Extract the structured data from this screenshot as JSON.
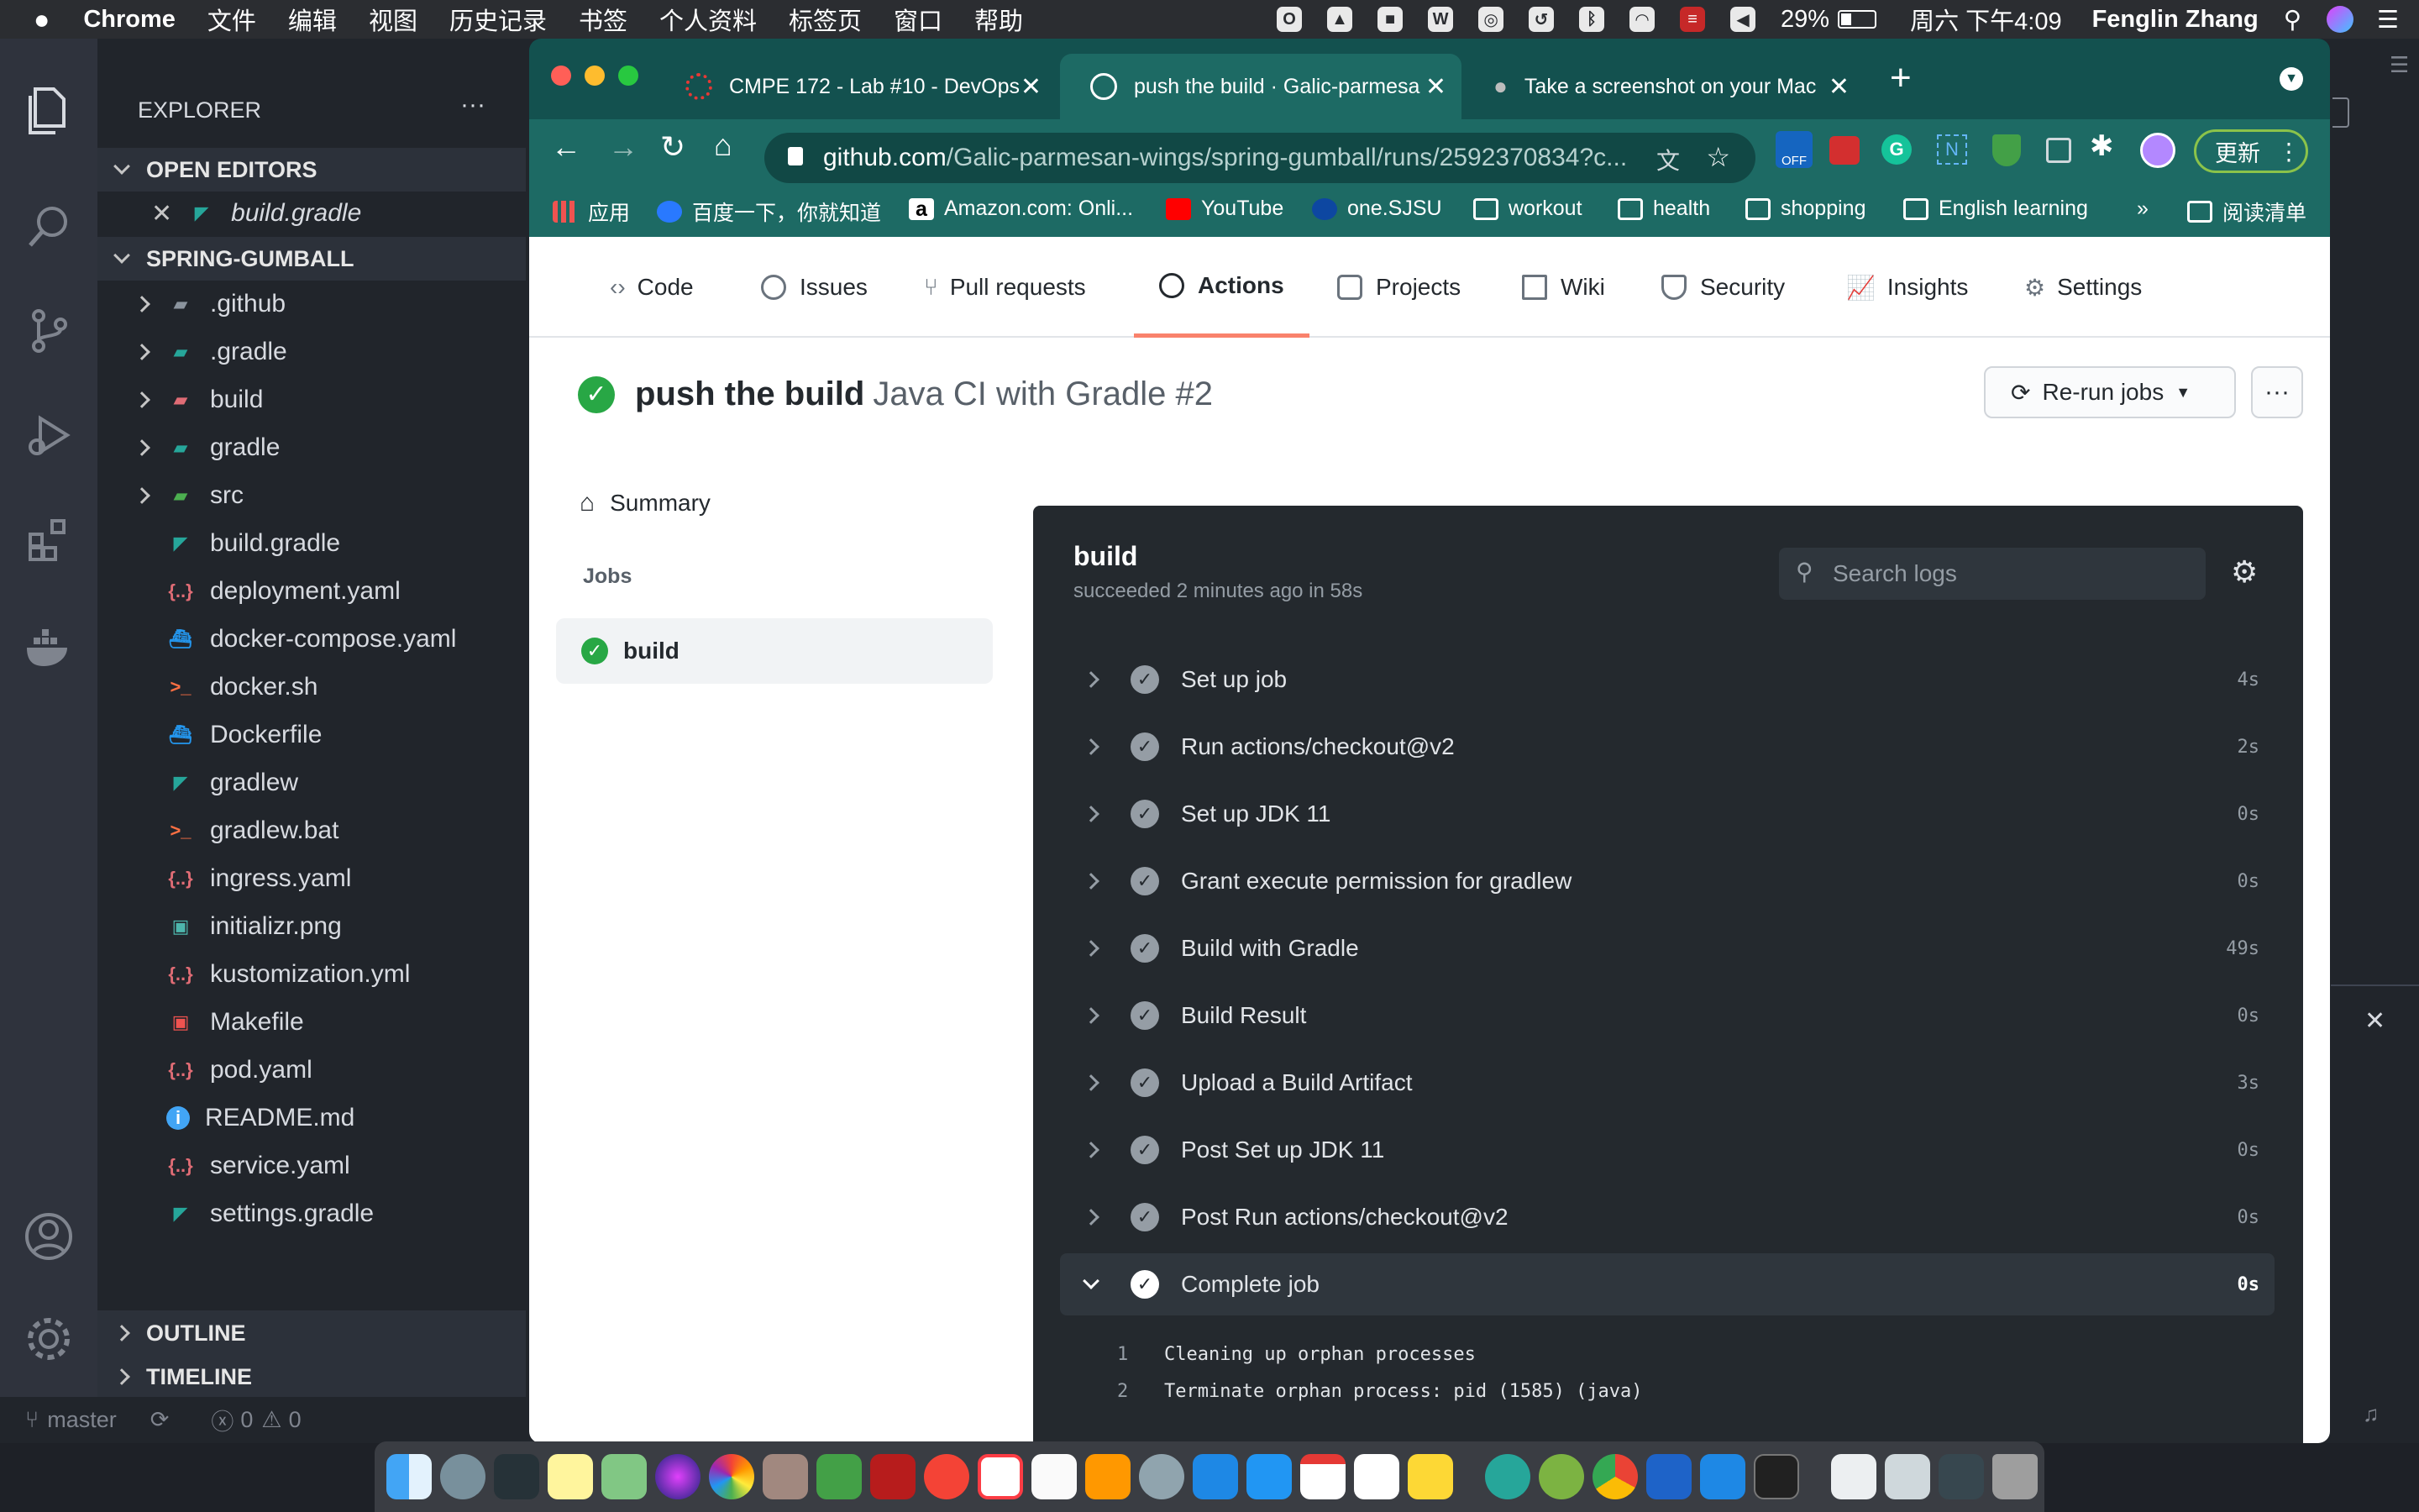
{
  "menubar": {
    "app": "Chrome",
    "items": [
      "文件",
      "编辑",
      "视图",
      "历史记录",
      "书签",
      "个人资料",
      "标签页",
      "窗口",
      "帮助"
    ],
    "battery": "29%",
    "clock": "周六 下午4:09",
    "user": "Fenglin Zhang"
  },
  "vscode": {
    "explorer_title": "EXPLORER",
    "explorer_more": "···",
    "open_editors": "OPEN EDITORS",
    "open_file": "build.gradle",
    "project": "SPRING-GUMBALL",
    "tree": [
      {
        "name": ".github",
        "type": "folder",
        "color": "#8b949e"
      },
      {
        "name": ".gradle",
        "type": "folder",
        "color": "#26a69a"
      },
      {
        "name": "build",
        "type": "folder",
        "color": "#e06c75"
      },
      {
        "name": "gradle",
        "type": "folder",
        "color": "#26a69a"
      },
      {
        "name": "src",
        "type": "folder",
        "color": "#4caf50"
      },
      {
        "name": "build.gradle",
        "type": "gradle",
        "color": "#26a69a"
      },
      {
        "name": "deployment.yaml",
        "type": "yaml",
        "color": "#e06c75"
      },
      {
        "name": "docker-compose.yaml",
        "type": "docker",
        "color": "#2496ed"
      },
      {
        "name": "docker.sh",
        "type": "shell",
        "color": "#ff7043"
      },
      {
        "name": "Dockerfile",
        "type": "docker",
        "color": "#2496ed"
      },
      {
        "name": "gradlew",
        "type": "gradle",
        "color": "#26a69a"
      },
      {
        "name": "gradlew.bat",
        "type": "shell",
        "color": "#ff7043"
      },
      {
        "name": "ingress.yaml",
        "type": "yaml",
        "color": "#e06c75"
      },
      {
        "name": "initializr.png",
        "type": "image",
        "color": "#4db6ac"
      },
      {
        "name": "kustomization.yml",
        "type": "yaml",
        "color": "#e06c75"
      },
      {
        "name": "Makefile",
        "type": "make",
        "color": "#ef5350"
      },
      {
        "name": "pod.yaml",
        "type": "yaml",
        "color": "#e06c75"
      },
      {
        "name": "README.md",
        "type": "info",
        "color": "#42a5f5"
      },
      {
        "name": "service.yaml",
        "type": "yaml",
        "color": "#e06c75"
      },
      {
        "name": "settings.gradle",
        "type": "gradle",
        "color": "#26a69a"
      }
    ],
    "outline": "OUTLINE",
    "timeline": "TIMELINE",
    "branch": "master",
    "errors": "0",
    "warnings": "0"
  },
  "chrome": {
    "tabs": [
      {
        "title": "CMPE 172 - Lab #10 - DevOps"
      },
      {
        "title": "push the build · Galic-parmesa"
      },
      {
        "title": "Take a screenshot on your Mac"
      }
    ],
    "url_host": "github.com",
    "url_path": "/Galic-parmesan-wings/spring-gumball/runs/2592370834?c...",
    "update_label": "更新",
    "extension_badge": "OFF",
    "bookmarks": [
      "应用",
      "百度一下，你就知道",
      "Amazon.com: Onli...",
      "YouTube",
      "one.SJSU",
      "workout",
      "health",
      "shopping",
      "English learning"
    ],
    "bookmarks_overflow": "»",
    "reading_list": "阅读清单"
  },
  "github": {
    "nav": [
      "Code",
      "Issues",
      "Pull requests",
      "Actions",
      "Projects",
      "Wiki",
      "Security",
      "Insights",
      "Settings"
    ],
    "active_nav": "Actions",
    "run_title": "push the build",
    "run_workflow": "Java CI with Gradle #2",
    "rerun_label": "Re-run jobs",
    "summary_label": "Summary",
    "jobs_label": "Jobs",
    "job_name": "build",
    "log": {
      "job": "build",
      "status": "succeeded 2 minutes ago in 58s",
      "search_placeholder": "Search logs",
      "steps": [
        {
          "name": "Set up job",
          "duration": "4s"
        },
        {
          "name": "Run actions/checkout@v2",
          "duration": "2s"
        },
        {
          "name": "Set up JDK 11",
          "duration": "0s"
        },
        {
          "name": "Grant execute permission for gradlew",
          "duration": "0s"
        },
        {
          "name": "Build with Gradle",
          "duration": "49s"
        },
        {
          "name": "Build Result",
          "duration": "0s"
        },
        {
          "name": "Upload a Build Artifact",
          "duration": "3s"
        },
        {
          "name": "Post Set up JDK 11",
          "duration": "0s"
        },
        {
          "name": "Post Run actions/checkout@v2",
          "duration": "0s"
        },
        {
          "name": "Complete job",
          "duration": "0s",
          "expanded": true
        }
      ],
      "lines": [
        {
          "n": "1",
          "text": "Cleaning up orphan processes"
        },
        {
          "n": "2",
          "text": "Terminate orphan process: pid (1585) (java)"
        }
      ]
    }
  },
  "colors": {
    "chrome_theme": "#1d6a64",
    "success": "#28a745",
    "active_tab_underline": "#f9826c"
  }
}
